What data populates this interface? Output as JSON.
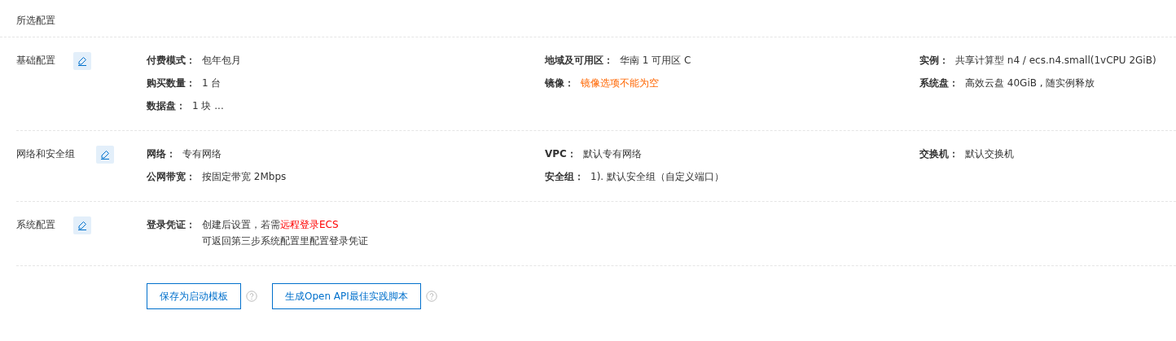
{
  "title": "所选配置",
  "sections": [
    {
      "label": "基础配置",
      "fields": [
        {
          "label": "付费模式：",
          "kind": "text",
          "value": "包年包月"
        },
        {
          "label": "地域及可用区：",
          "kind": "text",
          "value": "华南 1 可用区 C"
        },
        {
          "label": "实例：",
          "kind": "text",
          "value": "共享计算型 n4 / ecs.n4.small(1vCPU 2GiB)"
        },
        {
          "label": "购买数量：",
          "kind": "text",
          "value": "1 台"
        },
        {
          "label": "镜像：",
          "kind": "error",
          "value": "镜像选项不能为空"
        },
        {
          "label": "系统盘：",
          "kind": "text",
          "value": "高效云盘 40GiB , 随实例释放"
        },
        {
          "label": "数据盘：",
          "kind": "text",
          "value": "1 块 ..."
        }
      ]
    },
    {
      "label": "网络和安全组",
      "fields": [
        {
          "label": "网络：",
          "kind": "text",
          "value": "专有网络"
        },
        {
          "label": "VPC：",
          "kind": "text",
          "value": "默认专有网络"
        },
        {
          "label": "交换机：",
          "kind": "text",
          "value": "默认交换机"
        },
        {
          "label": "公网带宽：",
          "kind": "text",
          "value": "按固定带宽 2Mbps"
        },
        {
          "label": "安全组：",
          "kind": "text",
          "value": "1). 默认安全组（自定义端口）"
        }
      ]
    },
    {
      "label": "系统配置",
      "fields": [
        {
          "label": "登录凭证：",
          "kind": "link",
          "value": "创建后设置，若需",
          "link": "远程登录ECS",
          "note": "可返回第三步系统配置里配置登录凭证"
        }
      ]
    }
  ],
  "buttons": [
    "保存为启动模板",
    "生成Open API最佳实践脚本"
  ]
}
